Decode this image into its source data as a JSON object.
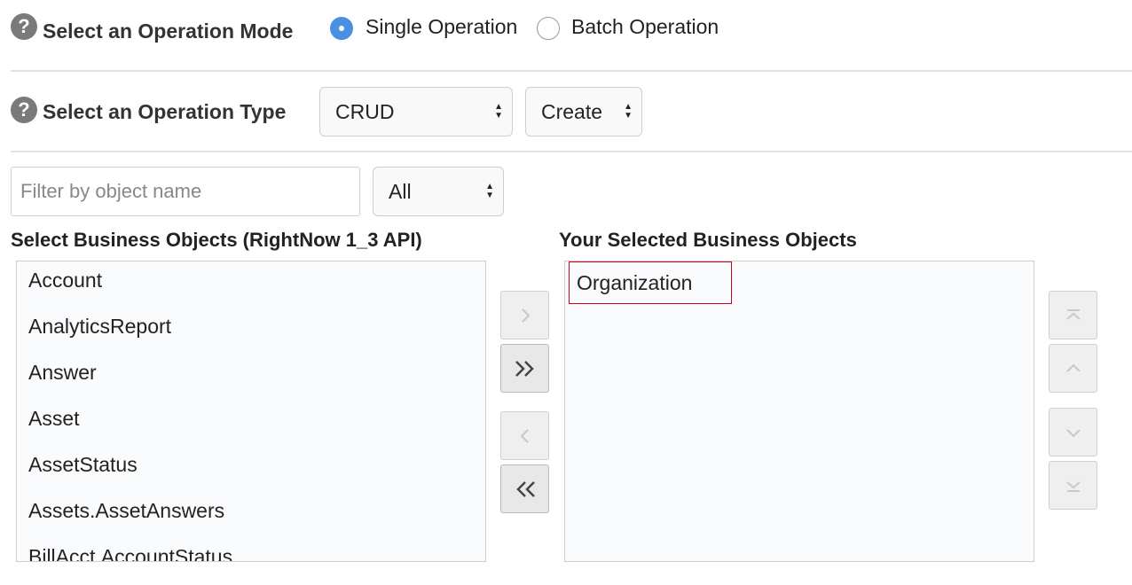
{
  "operation_mode": {
    "label": "Select an Operation Mode",
    "options": [
      {
        "label": "Single Operation",
        "checked": true
      },
      {
        "label": "Batch Operation",
        "checked": false
      }
    ]
  },
  "operation_type": {
    "label": "Select an Operation Type",
    "type_select": "CRUD",
    "action_select": "Create"
  },
  "filter": {
    "placeholder": "Filter by object name",
    "category_select": "All"
  },
  "available": {
    "title": "Select Business Objects (RightNow 1_3 API)",
    "items": [
      "Account",
      "AnalyticsReport",
      "Answer",
      "Asset",
      "AssetStatus",
      "Assets.AssetAnswers",
      "BillAcct.AccountStatus"
    ]
  },
  "selected": {
    "title": "Your Selected Business Objects",
    "items": [
      "Organization"
    ]
  },
  "colors": {
    "accent": "#4a90e2",
    "highlight_border": "#d0021b"
  },
  "icons": {
    "help": "?",
    "move_right": "chevron-right",
    "move_all_right": "double-chevron-right",
    "move_left": "chevron-left",
    "move_all_left": "double-chevron-left",
    "move_top": "move-top",
    "move_up": "chevron-up",
    "move_down": "chevron-down",
    "move_bottom": "move-bottom"
  }
}
